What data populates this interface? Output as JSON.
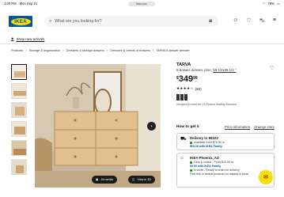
{
  "status": {
    "time": "1:00 PM",
    "date": "Mon Sep 21",
    "url": "ikea.com",
    "battery": "78%"
  },
  "header": {
    "logo": "IKEA",
    "search_placeholder": "What are you looking for?"
  },
  "nav": {
    "shop_new": "Shop new arrivals"
  },
  "breadcrumbs": [
    "Products",
    "Storage & organization",
    "Dressers & storage drawers",
    "Dressers & chests of drawers",
    "TARVA 6-drawer dresser"
  ],
  "product": {
    "name": "TARVA",
    "description": "6-drawer dresser, pine,",
    "dimensions": "59 1/2x36 1/4 \"",
    "price_currency": "$",
    "price_dollars": "349",
    "price_cents": "99",
    "rating_count": "(58)",
    "stars": "★★★★☆",
    "badge_note": "Designed to meet the US Federal Stability Standard"
  },
  "gallery": {
    "all_media": "All media",
    "view_3d": "View in 3D"
  },
  "howto": {
    "title": "How to get it",
    "price_info": "Price information",
    "change_store": "Change store"
  },
  "delivery": {
    "title": "Delivery to 86322",
    "line1": "Available from $79.00 or",
    "line1_blue": "$69.00 with IKEA Family"
  },
  "store": {
    "title": "IKEA Phoenix, AZ",
    "line1": "Click & collect - From $10.00 or",
    "line1_blue": "$9.00 with IKEA Family",
    "line2": "In store - Ready to order for delivery",
    "line3": "Find this or similar products on display in store"
  },
  "colors": {
    "ikea_blue": "#0058a3",
    "ikea_yellow": "#ffdb00"
  }
}
